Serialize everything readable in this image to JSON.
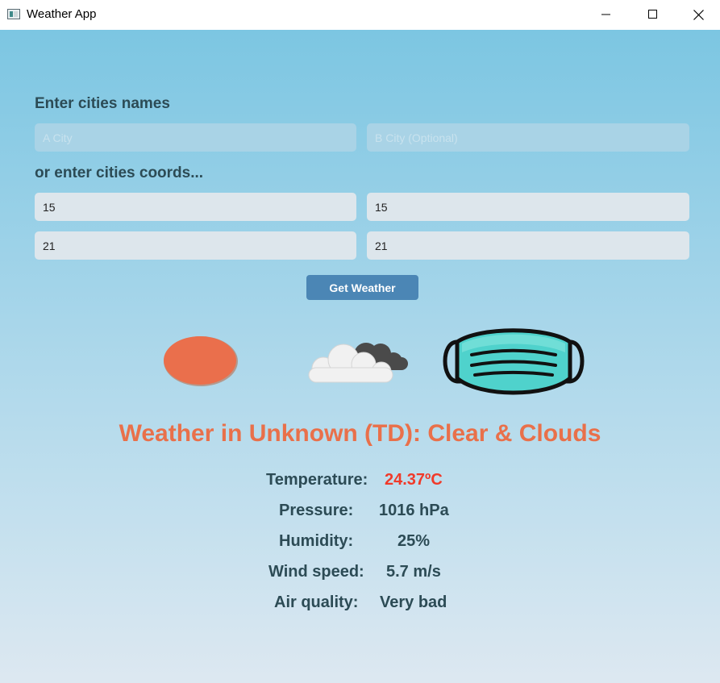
{
  "window": {
    "title": "Weather App"
  },
  "form": {
    "names_label": "Enter cities names",
    "city_a_placeholder": "A City",
    "city_b_placeholder": "B City (Optional)",
    "coords_label": "or enter cities coords...",
    "coord_a1": "15",
    "coord_b1": "15",
    "coord_a2": "21",
    "coord_b2": "21",
    "submit_label": "Get Weather"
  },
  "icons": [
    "sun-icon",
    "clouds-icon",
    "face-mask-icon"
  ],
  "colors": {
    "accent": "#e9704a",
    "temperature": "#f03a2a",
    "button": "#4b86b5",
    "text": "#2c4b55"
  },
  "result": {
    "title": "Weather in Unknown (TD): Clear & Clouds",
    "temperature_label": "Temperature:",
    "temperature_value": "24.37ºC",
    "pressure_label": "Pressure:",
    "pressure_value": "1016 hPa",
    "humidity_label": "Humidity:",
    "humidity_value": "25%",
    "wind_label": "Wind speed:",
    "wind_value": "5.7 m/s",
    "air_label": "Air quality:",
    "air_value": "Very bad"
  }
}
